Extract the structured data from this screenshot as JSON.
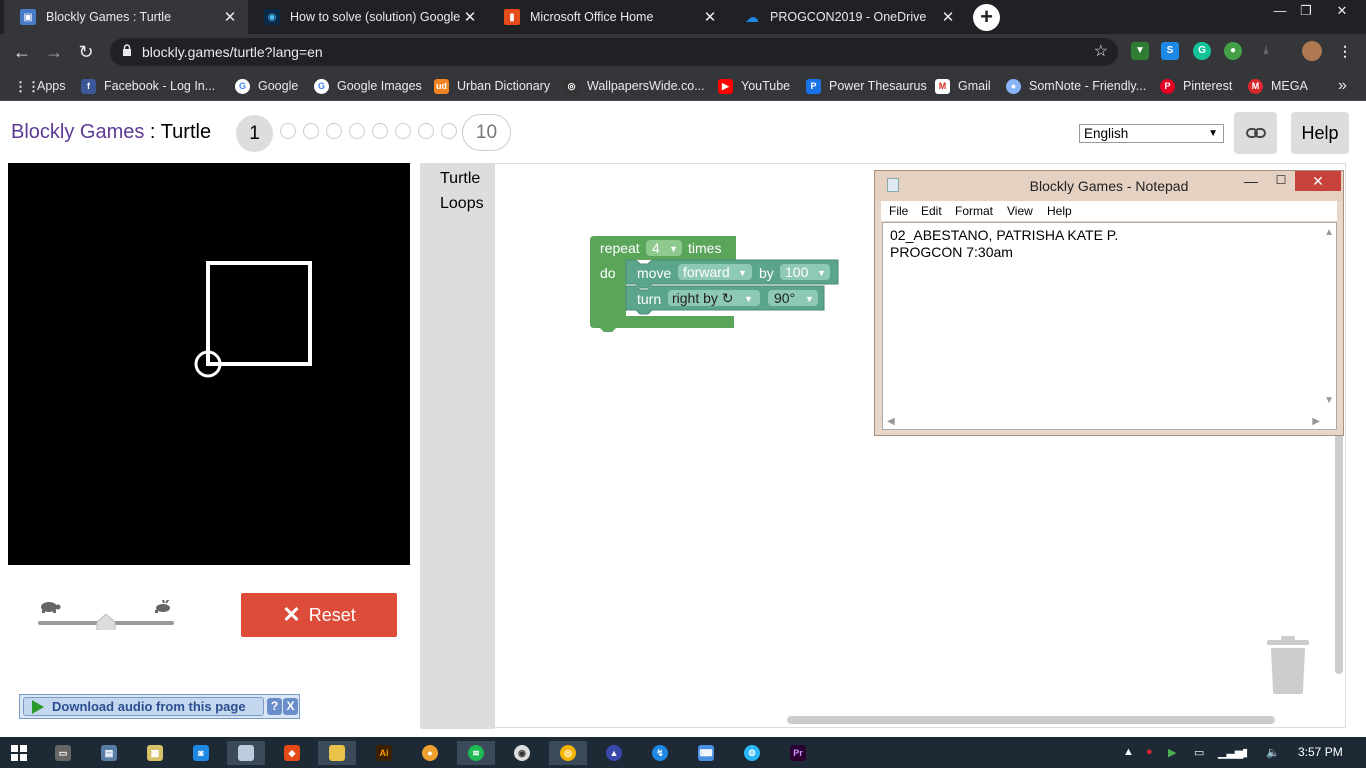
{
  "browser": {
    "tabs": [
      {
        "title": "Blockly Games : Turtle",
        "icon": "puzzle-icon",
        "color": "#4a7ac8",
        "active": true
      },
      {
        "title": "How to solve (solution) Google's",
        "icon": "eye-icon",
        "color": "#1e88e5",
        "active": false
      },
      {
        "title": "Microsoft Office Home",
        "icon": "office-icon",
        "color": "#e64a19",
        "active": false
      },
      {
        "title": "PROGCON2019 - OneDrive",
        "icon": "cloud-icon",
        "color": "#1e88e5",
        "active": false
      }
    ],
    "url": "blockly.games/turtle?lang=en",
    "bookmarks": [
      {
        "label": "Apps",
        "icon": "apps-grid-icon",
        "color": "#e8eaed"
      },
      {
        "label": "Facebook - Log In...",
        "icon": "facebook-icon",
        "color": "#3b5998"
      },
      {
        "label": "Google",
        "icon": "google-icon",
        "color": "#ffffff"
      },
      {
        "label": "Google Images",
        "icon": "google-icon",
        "color": "#ffffff"
      },
      {
        "label": "Urban Dictionary",
        "icon": "urban-dictionary-icon",
        "color": "#f58220"
      },
      {
        "label": "WallpapersWide.co...",
        "icon": "wallpaper-icon",
        "color": "#333333"
      },
      {
        "label": "YouTube",
        "icon": "youtube-icon",
        "color": "#ff0000"
      },
      {
        "label": "Power Thesaurus",
        "icon": "power-thesaurus-icon",
        "color": "#1a73e8"
      },
      {
        "label": "Gmail",
        "icon": "gmail-icon",
        "color": "#ffffff"
      },
      {
        "label": "SomNote - Friendly...",
        "icon": "somnote-icon",
        "color": "#8ab4f8"
      },
      {
        "label": "Pinterest",
        "icon": "pinterest-icon",
        "color": "#e60023"
      },
      {
        "label": "MEGA",
        "icon": "mega-icon",
        "color": "#d9272e"
      }
    ],
    "more_bookmarks": "»"
  },
  "game": {
    "brand": "Blockly Games",
    "separator": " : ",
    "name": "Turtle",
    "current_level": "1",
    "last_level": "10",
    "language": "English",
    "help_label": "Help",
    "reset_label": "Reset",
    "speed_fraction": 0.5,
    "toolbox": [
      "Turtle",
      "Loops"
    ],
    "blocks": {
      "repeat_label": "repeat",
      "repeat_count": "4",
      "times_label": "times",
      "do_label": "do",
      "move_label": "move",
      "move_dir": "forward",
      "by_label": "by",
      "move_amount": "100",
      "turn_label": "turn",
      "turn_dir": "right by ↻",
      "turn_angle": "90°"
    }
  },
  "download_bar": {
    "label": "Download audio from this page",
    "help": "?",
    "close": "X"
  },
  "notepad": {
    "title": "Blockly Games - Notepad",
    "menu": [
      "File",
      "Edit",
      "Format",
      "View",
      "Help"
    ],
    "text": "02_ABESTANO, PATRISHA KATE P.\nPROGCON 7:30am"
  },
  "taskbar": {
    "time": "3:57 PM"
  },
  "colors": {
    "block_green": "#5ba58c",
    "block_loop": "#5ba55b",
    "reset_red": "#dd4b39",
    "brand_purple": "#5e3a96"
  }
}
